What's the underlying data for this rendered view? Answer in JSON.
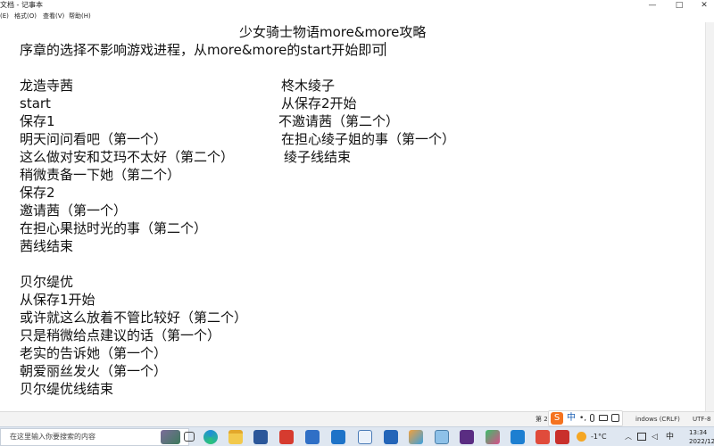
{
  "window": {
    "title": "文档 - 记事本",
    "minimize_glyph": "—",
    "maximize_glyph": "□",
    "close_glyph": "✕"
  },
  "menubar": {
    "items": [
      "(E)",
      "格式(O)",
      "查看(V)",
      "帮助(H)"
    ]
  },
  "document": {
    "title": "少女骑士物语more&more攻略",
    "intro": "序章的选择不影响游戏进程，从more&more的start开始即可",
    "left_column": [
      "龙造寺茜",
      "start",
      "保存1",
      "明天问问看吧（第一个）",
      "这么做对安和艾玛不太好（第二个）",
      "稍微责备一下她（第二个）",
      "保存2",
      "邀请茜（第一个）",
      "在担心果挞时光的事（第二个）",
      "茜线结束",
      "",
      "贝尔缇优",
      "从保存1开始",
      "或许就这么放着不管比较好（第二个）",
      "只是稍微给点建议的话（第一个）",
      "老实的告诉她（第一个）",
      "朝爱丽丝发火（第一个）",
      "贝尔缇优线结束"
    ],
    "right_column": [
      "柊木绫子",
      "从保存2开始",
      "不邀请茜（第二个）",
      "在担心绫子姐的事（第一个）",
      "绫子线结束"
    ]
  },
  "statusbar": {
    "position": "第 2",
    "encoding_line": "indows (CRLF)",
    "encoding": "UTF-8"
  },
  "taskbar": {
    "search_placeholder": "在这里输入你要搜索的内容",
    "ime_label": "中",
    "temperature": "-1°C",
    "time": "13:34",
    "date": "2022/12"
  },
  "colors": {
    "sogou_orange": "#f5731f",
    "taskbar_bg": "#dfe7f1"
  }
}
